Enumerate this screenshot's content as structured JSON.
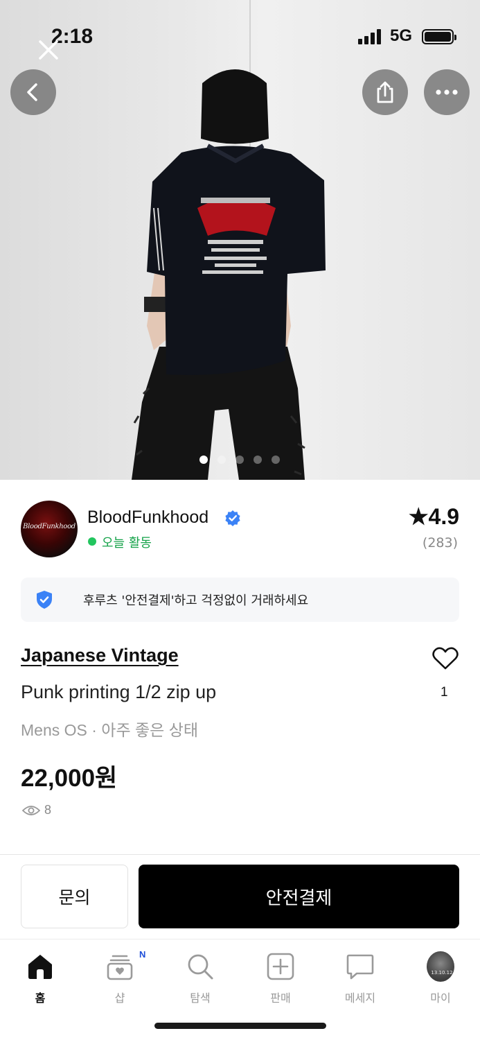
{
  "status_bar": {
    "time": "2:18",
    "network": "5G"
  },
  "photo": {
    "page_count": 5,
    "current_page": 1
  },
  "seller": {
    "name": "BloodFunkhood",
    "avatar_text": "BloodFunkhood",
    "activity": "오늘 활동",
    "rating": "★4.9",
    "review_count": "(283)",
    "verified": true
  },
  "safe_banner": "후루츠 '안전결제'하고 걱정없이 거래하세요",
  "product": {
    "brand_title": "Japanese Vintage",
    "subtitle": "Punk printing 1/2 zip up",
    "meta": "Mens OS · 아주 좋은 상태",
    "price": "22,000원",
    "views": "8",
    "likes": "1"
  },
  "actions": {
    "inquiry": "문의",
    "safe_pay": "안전결제"
  },
  "tabbar": {
    "home": "홈",
    "shop": "샵",
    "shop_badge": "N",
    "search": "탐색",
    "sell": "판매",
    "messages": "메세지",
    "my": "마이",
    "my_avatar_text": "13.10.12"
  },
  "colors": {
    "accent_green": "#16a34a",
    "verified_blue": "#3b82f6",
    "primary": "#000000"
  }
}
